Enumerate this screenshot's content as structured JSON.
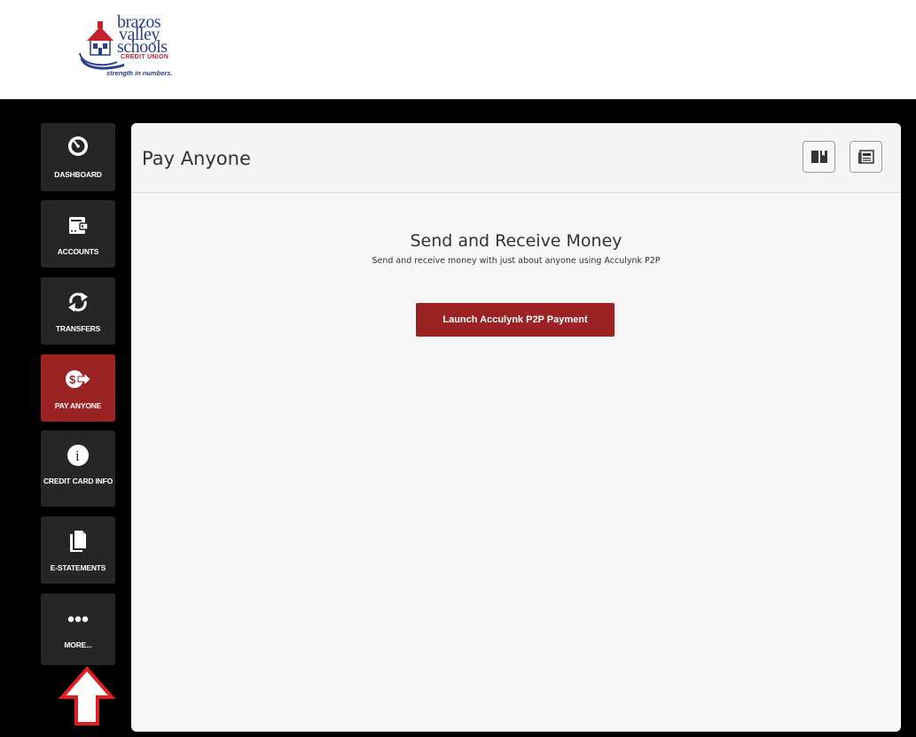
{
  "brand": {
    "line1": "brazos",
    "line2": "valley",
    "line3": "schools",
    "credit_union": "CREDIT UNION",
    "tagline": "strength in numbers."
  },
  "sidebar": {
    "items": [
      {
        "label": "DASHBOARD",
        "icon": "speedometer-icon",
        "active": false
      },
      {
        "label": "ACCOUNTS",
        "icon": "wallet-icon",
        "active": false
      },
      {
        "label": "TRANSFERS",
        "icon": "transfer-arrows-icon",
        "active": false
      },
      {
        "label": "PAY ANYONE",
        "icon": "dollar-send-icon",
        "active": true
      },
      {
        "label": "CREDIT CARD INFO",
        "icon": "info-icon",
        "active": false
      },
      {
        "label": "E-STATEMENTS",
        "icon": "document-icon",
        "active": false
      },
      {
        "label": "MORE...",
        "icon": "more-dots-icon",
        "active": false
      }
    ]
  },
  "panel": {
    "title": "Pay Anyone",
    "toolbar": [
      {
        "icon": "book-icon"
      },
      {
        "icon": "newspaper-icon"
      }
    ]
  },
  "content": {
    "heading": "Send and Receive Money",
    "subheading": "Send and receive money with just about anyone using Acculynk P2P",
    "launch_label": "Launch Acculynk P2P Payment"
  },
  "colors": {
    "accent": "#9b2323",
    "sidebar_bg": "#262626",
    "page_bg": "#000000",
    "brand_blue": "#2a3f8f",
    "brand_red": "#c8202a"
  }
}
